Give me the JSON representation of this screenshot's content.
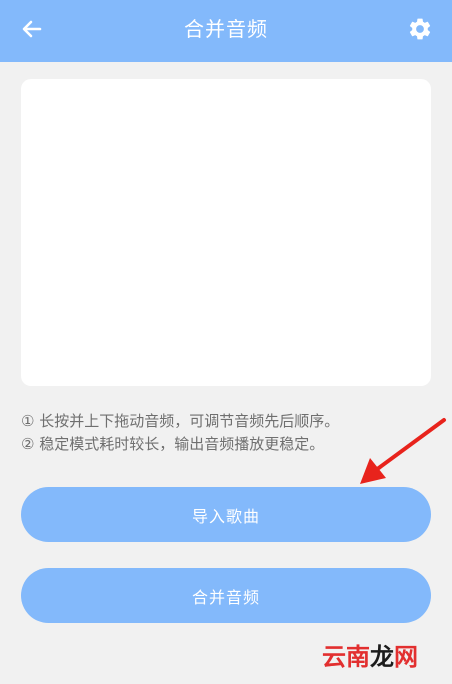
{
  "header": {
    "title": "合并音频",
    "back_icon": "arrow-left-icon",
    "settings_icon": "gear-icon"
  },
  "tips": [
    "① 长按并上下拖动音频，可调节音频先后顺序。",
    "② 稳定模式耗时较长，输出音频播放更稳定。"
  ],
  "buttons": {
    "import_label": "导入歌曲",
    "merge_label": "合并音频"
  },
  "watermark": {
    "part1": "云南",
    "part2": "龙",
    "part3": "网"
  },
  "colors": {
    "accent": "#83b9fb",
    "background": "#f1f1f1",
    "annotation_arrow": "#e8231c"
  }
}
